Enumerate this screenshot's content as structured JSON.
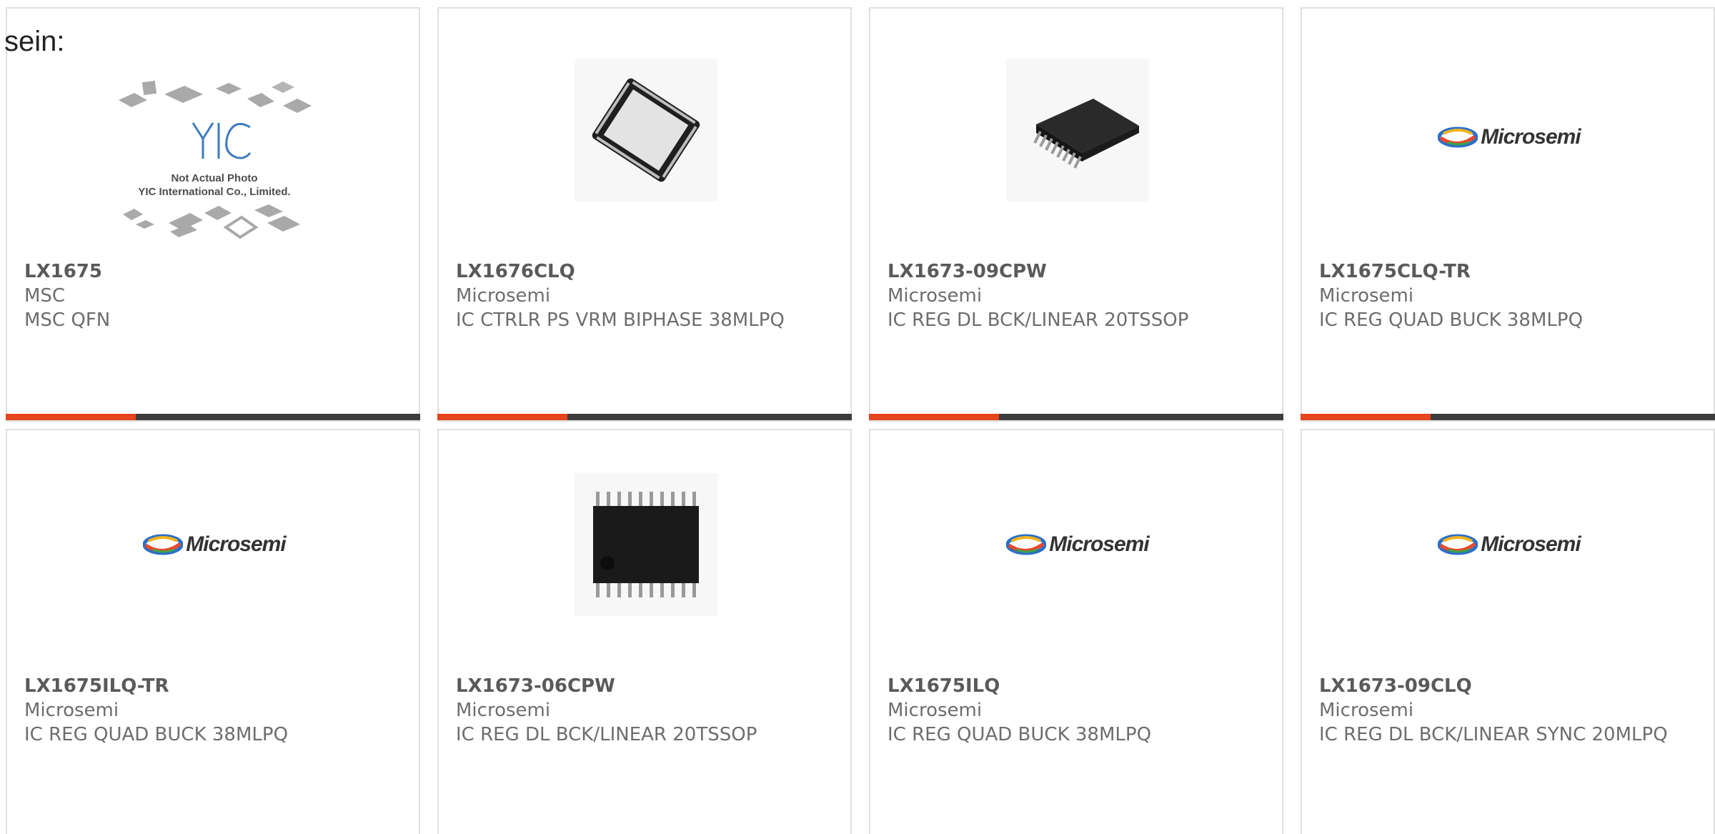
{
  "page": {
    "intro_text": "sein:"
  },
  "placeholder_image": {
    "line1": "Not Actual Photo",
    "line2": "YIC International Co., Limited.",
    "logo_text": "YIC"
  },
  "brand_logo_text": "Microsemi",
  "colors": {
    "accent": "#e6451e",
    "bar": "#3d3d3d",
    "border": "#e0e0e0",
    "text": "#6d6d6d"
  },
  "products": [
    {
      "part_number": "LX1675",
      "manufacturer": "MSC",
      "description": "MSC QFN",
      "image": "placeholder-photo"
    },
    {
      "part_number": "LX1676CLQ",
      "manufacturer": "Microsemi",
      "description": "IC CTRLR PS VRM BIPHASE 38MLPQ",
      "image": "qfn-chip-photo"
    },
    {
      "part_number": "LX1673-09CPW",
      "manufacturer": "Microsemi",
      "description": "IC REG DL BCK/LINEAR 20TSSOP",
      "image": "tssop-side-photo"
    },
    {
      "part_number": "LX1675CLQ-TR",
      "manufacturer": "Microsemi",
      "description": "IC REG QUAD BUCK 38MLPQ",
      "image": "microsemi-logo"
    },
    {
      "part_number": "LX1675ILQ-TR",
      "manufacturer": "Microsemi",
      "description": "IC REG QUAD BUCK 38MLPQ",
      "image": "microsemi-logo"
    },
    {
      "part_number": "LX1673-06CPW",
      "manufacturer": "Microsemi",
      "description": "IC REG DL BCK/LINEAR 20TSSOP",
      "image": "tssop-top-photo"
    },
    {
      "part_number": "LX1675ILQ",
      "manufacturer": "Microsemi",
      "description": "IC REG QUAD BUCK 38MLPQ",
      "image": "microsemi-logo"
    },
    {
      "part_number": "LX1673-09CLQ",
      "manufacturer": "Microsemi",
      "description": "IC REG DL BCK/LINEAR SYNC 20MLPQ",
      "image": "microsemi-logo"
    }
  ]
}
